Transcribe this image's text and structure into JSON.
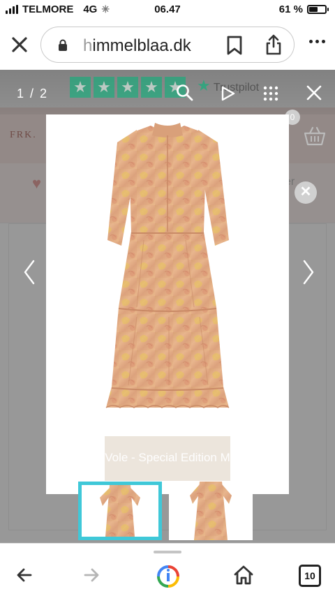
{
  "status_bar": {
    "carrier": "TELMORE",
    "network": "4G",
    "time": "06.47",
    "battery": "61 %"
  },
  "browser": {
    "url_dim": "h",
    "url": "immelblaa.dk",
    "icons": [
      "close-icon",
      "lock-icon",
      "bookmark-icon",
      "share-icon",
      "more-icon"
    ]
  },
  "gallery": {
    "counter": "1 / 2",
    "trustpilot": "Trustpilot",
    "caption": "Vole - Special Edition M",
    "cart_count": "0",
    "icons": [
      "zoom-icon",
      "play-icon",
      "grid-icon",
      "close-icon",
      "chevron-left-icon",
      "chevron-right-icon"
    ]
  },
  "colors": {
    "accent": "#3fc8d8",
    "trustpilot_green": "#00b67a",
    "dress_base": "#e3a97e",
    "dress_pattern": "#e7c55b"
  },
  "bottom_bar": {
    "tab_count": "10",
    "icons": [
      "back-arrow-icon",
      "forward-arrow-icon",
      "google-lens-icon",
      "home-icon",
      "tabs-icon"
    ]
  }
}
